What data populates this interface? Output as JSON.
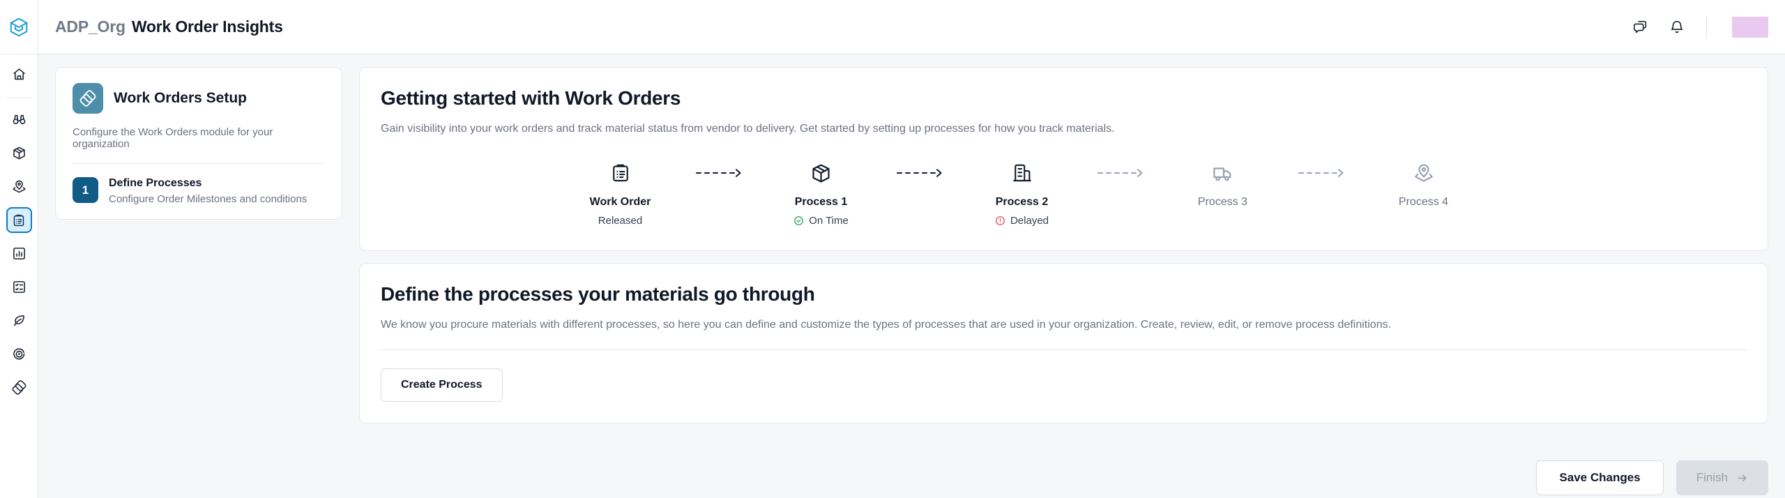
{
  "header": {
    "org_name": "ADP_Org",
    "page_title": "Work Order Insights",
    "logo_icon": "cube-logo-icon",
    "messages_icon": "chat-bubbles-icon",
    "notifications_icon": "bell-icon",
    "avatar": "user-avatar",
    "avatar_color": "#e9c9ef"
  },
  "sidebar": {
    "items": [
      {
        "icon": "home-icon",
        "active": false
      },
      {
        "icon": "binoculars-icon",
        "active": false
      },
      {
        "icon": "package-icon",
        "active": false
      },
      {
        "icon": "location-pin-icon",
        "active": false
      },
      {
        "icon": "clipboard-icon",
        "active": true
      },
      {
        "icon": "bar-chart-icon",
        "active": false
      },
      {
        "icon": "task-list-icon",
        "active": false
      },
      {
        "icon": "leaf-icon",
        "active": false
      },
      {
        "icon": "target-scan-icon",
        "active": false
      },
      {
        "icon": "layers-diamond-icon",
        "active": false
      }
    ]
  },
  "setup_card": {
    "icon": "layers-diamond-icon",
    "icon_color": "#4d8fa8",
    "title": "Work Orders Setup",
    "subtitle": "Configure the Work Orders module for your organization",
    "steps": [
      {
        "number": "1",
        "title": "Define Processes",
        "subtitle": "Configure Order Milestones and conditions",
        "badge_color": "#115b87"
      }
    ]
  },
  "getting_started": {
    "heading": "Getting started with Work Orders",
    "description": "Gain visibility into your work orders and track material status from vendor to delivery. Get started by setting up processes for how you track materials.",
    "flow": [
      {
        "icon": "clipboard-icon",
        "label": "Work Order",
        "status": "Released",
        "status_type": "plain",
        "muted": false
      },
      {
        "icon": "package-icon",
        "label": "Process 1",
        "status": "On Time",
        "status_type": "ontime",
        "muted": false
      },
      {
        "icon": "factory-icon",
        "label": "Process 2",
        "status": "Delayed",
        "status_type": "delayed",
        "muted": false
      },
      {
        "icon": "truck-icon",
        "label": "Process 3",
        "status": "",
        "status_type": "none",
        "muted": true
      },
      {
        "icon": "location-pin-icon",
        "label": "Process 4",
        "status": "",
        "status_type": "none",
        "muted": true
      }
    ],
    "status_colors": {
      "on_time": "#1f9d55",
      "delayed": "#e04b4b"
    },
    "arrow_icon": "dashed-arrow-right-icon"
  },
  "define_processes": {
    "heading": "Define the processes your materials go through",
    "description": "We know you procure materials with different processes, so here you can define and customize the types of processes that are used in your organization. Create, review, edit, or remove process definitions.",
    "create_button": "Create Process"
  },
  "footer": {
    "save_label": "Save Changes",
    "finish_label": "Finish",
    "finish_icon": "arrow-right-icon",
    "finish_disabled": true
  }
}
